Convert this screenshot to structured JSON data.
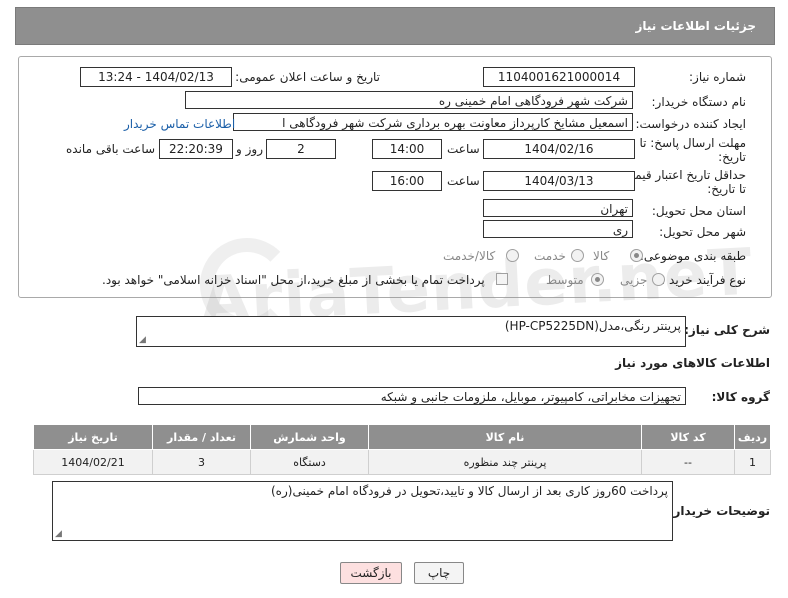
{
  "header": {
    "title": "جزئیات اطلاعات نیاز"
  },
  "form": {
    "need_number_label": "شماره نیاز:",
    "need_number": "1104001621000014",
    "announce_label": "تاریخ و ساعت اعلان عمومی:",
    "announce_value": "1404/02/13 - 13:24",
    "buyer_org_label": "نام دستگاه خریدار:",
    "buyer_org": "شرکت شهر فرودگاهی امام خمینی  ره",
    "requester_label": "ایجاد کننده درخواست:",
    "requester": "اسمعیل مشایخ کارپرداز معاونت بهره برداری شرکت شهر فرودگاهی ا",
    "contact_link": "اطلاعات تماس خریدار",
    "deadline_label_1": "مهلت ارسال پاسخ: تا",
    "deadline_label_2": "تاریخ:",
    "deadline_date": "1404/02/16",
    "time_word": "ساعت",
    "deadline_time": "14:00",
    "days_value": "2",
    "days_word": "روز و",
    "remaining_time": "22:20:39",
    "remaining_word": "ساعت باقی مانده",
    "min_validity_label_1": "حداقل تاریخ اعتبار قیمت:",
    "min_validity_label_2": "تا تاریخ:",
    "validity_date": "1404/03/13",
    "validity_time": "16:00",
    "province_label": "استان محل تحویل:",
    "province": "تهران",
    "city_label": "شهر محل تحویل:",
    "city": "ری",
    "category_label": "طبقه بندی موضوعی:",
    "category_options": [
      "کالا",
      "خدمت",
      "کالا/خدمت"
    ],
    "process_label": "نوع فرآیند خرید :",
    "process_options": [
      "جزیی",
      "متوسط"
    ],
    "payment_note": "پرداخت تمام یا بخشی از مبلغ خرید،از محل \"اسناد خزانه اسلامی\" خواهد بود."
  },
  "description": {
    "label": "شرح کلی نیاز:",
    "value": "پرینتر رنگی،مدل(HP-CP5225DN)"
  },
  "goods": {
    "section_title": "اطلاعات کالاهای مورد نیاز",
    "group_label": "گروه کالا:",
    "group_value": "تجهیزات مخابراتی، کامپیوتر، موبایل، ملزومات جانبی و شبکه",
    "columns": [
      "ردیف",
      "کد کالا",
      "نام کالا",
      "واحد شمارش",
      "تعداد / مقدار",
      "تاریخ نیاز"
    ],
    "rows": [
      {
        "row": "1",
        "code": "--",
        "name": "پرینتر چند منظوره",
        "unit": "دستگاه",
        "qty": "3",
        "date": "1404/02/21"
      }
    ]
  },
  "buyer_notes": {
    "label": "توضیحات خریدار:",
    "value": "پرداخت 60روز کاری بعد از ارسال کالا و تایید،تحویل در فرودگاه امام خمینی(ره)"
  },
  "buttons": {
    "print": "چاپ",
    "back": "بازگشت"
  },
  "watermark": "AriaTender.neT",
  "colors": {
    "header_bg": "#8f8f8f",
    "link": "#1b5fa8",
    "back_button_bg": "#fde0e0"
  }
}
